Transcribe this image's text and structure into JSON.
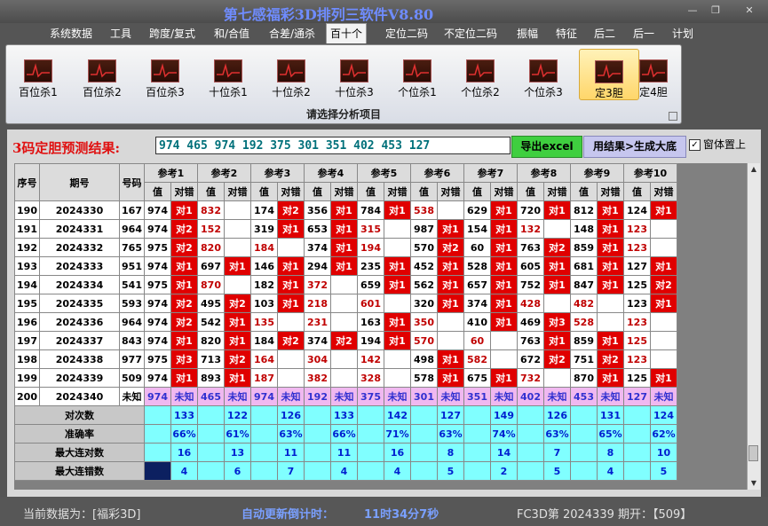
{
  "window": {
    "title": "第七感福彩3D排列三软件V8.80",
    "min": "—",
    "max": "❐",
    "close": "✕"
  },
  "menu": [
    "系统数据",
    "工具",
    "跨度/复式",
    "和/合值",
    "合差/通杀",
    "百十个",
    "定位二码",
    "不定位二码",
    "振幅",
    "特征",
    "后二",
    "后一",
    "计划"
  ],
  "menu_active": 5,
  "ribbon": {
    "buttons": [
      "百位杀1",
      "百位杀2",
      "百位杀3",
      "十位杀1",
      "十位杀2",
      "十位杀3",
      "个位杀1",
      "个位杀2",
      "个位杀3",
      "定3胆",
      "定4胆"
    ],
    "selected": 9,
    "caption": "请选择分析项目"
  },
  "prediction": {
    "label": "3码定胆预测结果:",
    "value": "974 465 974 192 375 301 351 402 453 127",
    "export_button": "导出excel",
    "generate_button": "用结果>生成大底",
    "ontop_label": "窗体置上",
    "ontop_checked": "✓"
  },
  "table": {
    "headers": {
      "seq": "序号",
      "period": "期号",
      "number": "号码",
      "val": "值",
      "cmp": "对错"
    },
    "refs": [
      "参考1",
      "参考2",
      "参考3",
      "参考4",
      "参考5",
      "参考6",
      "参考7",
      "参考8",
      "参考9",
      "参考10"
    ],
    "rows": [
      {
        "seq": "190",
        "period": "2024330",
        "num": "167",
        "refs": [
          [
            "974",
            "对1"
          ],
          [
            "832",
            ""
          ],
          [
            "174",
            "对2"
          ],
          [
            "356",
            "对1"
          ],
          [
            "784",
            "对1"
          ],
          [
            "538",
            ""
          ],
          [
            "629",
            "对1"
          ],
          [
            "720",
            "对1"
          ],
          [
            "812",
            "对1"
          ],
          [
            "124",
            "对1"
          ]
        ]
      },
      {
        "seq": "191",
        "period": "2024331",
        "num": "964",
        "refs": [
          [
            "974",
            "对2"
          ],
          [
            "152",
            ""
          ],
          [
            "319",
            "对1"
          ],
          [
            "653",
            "对1"
          ],
          [
            "315",
            ""
          ],
          [
            "987",
            "对1"
          ],
          [
            "154",
            "对1"
          ],
          [
            "132",
            ""
          ],
          [
            "148",
            "对1"
          ],
          [
            "123",
            ""
          ]
        ]
      },
      {
        "seq": "192",
        "period": "2024332",
        "num": "765",
        "refs": [
          [
            "975",
            "对2"
          ],
          [
            "820",
            ""
          ],
          [
            "184",
            ""
          ],
          [
            "374",
            "对1"
          ],
          [
            "194",
            ""
          ],
          [
            "570",
            "对2"
          ],
          [
            "60",
            "对1"
          ],
          [
            "763",
            "对2"
          ],
          [
            "859",
            "对1"
          ],
          [
            "123",
            ""
          ]
        ]
      },
      {
        "seq": "193",
        "period": "2024333",
        "num": "951",
        "refs": [
          [
            "974",
            "对1"
          ],
          [
            "697",
            "对1"
          ],
          [
            "146",
            "对1"
          ],
          [
            "294",
            "对1"
          ],
          [
            "235",
            "对1"
          ],
          [
            "452",
            "对1"
          ],
          [
            "528",
            "对1"
          ],
          [
            "605",
            "对1"
          ],
          [
            "681",
            "对1"
          ],
          [
            "127",
            "对1"
          ]
        ]
      },
      {
        "seq": "194",
        "period": "2024334",
        "num": "541",
        "refs": [
          [
            "975",
            "对1"
          ],
          [
            "870",
            ""
          ],
          [
            "182",
            "对1"
          ],
          [
            "372",
            ""
          ],
          [
            "659",
            "对1"
          ],
          [
            "562",
            "对1"
          ],
          [
            "657",
            "对1"
          ],
          [
            "752",
            "对1"
          ],
          [
            "847",
            "对1"
          ],
          [
            "125",
            "对2"
          ]
        ]
      },
      {
        "seq": "195",
        "period": "2024335",
        "num": "593",
        "refs": [
          [
            "974",
            "对2"
          ],
          [
            "495",
            "对2"
          ],
          [
            "103",
            "对1"
          ],
          [
            "218",
            ""
          ],
          [
            "601",
            ""
          ],
          [
            "320",
            "对1"
          ],
          [
            "374",
            "对1"
          ],
          [
            "428",
            ""
          ],
          [
            "482",
            ""
          ],
          [
            "123",
            "对1"
          ]
        ]
      },
      {
        "seq": "196",
        "period": "2024336",
        "num": "964",
        "refs": [
          [
            "974",
            "对2"
          ],
          [
            "542",
            "对1"
          ],
          [
            "135",
            ""
          ],
          [
            "231",
            ""
          ],
          [
            "163",
            "对1"
          ],
          [
            "350",
            ""
          ],
          [
            "410",
            "对1"
          ],
          [
            "469",
            "对3"
          ],
          [
            "528",
            ""
          ],
          [
            "123",
            ""
          ]
        ]
      },
      {
        "seq": "197",
        "period": "2024337",
        "num": "843",
        "refs": [
          [
            "974",
            "对1"
          ],
          [
            "820",
            "对1"
          ],
          [
            "184",
            "对2"
          ],
          [
            "374",
            "对2"
          ],
          [
            "194",
            "对1"
          ],
          [
            "570",
            ""
          ],
          [
            "60",
            ""
          ],
          [
            "763",
            "对1"
          ],
          [
            "859",
            "对1"
          ],
          [
            "125",
            ""
          ]
        ]
      },
      {
        "seq": "198",
        "period": "2024338",
        "num": "977",
        "refs": [
          [
            "975",
            "对3"
          ],
          [
            "713",
            "对2"
          ],
          [
            "164",
            ""
          ],
          [
            "304",
            ""
          ],
          [
            "142",
            ""
          ],
          [
            "498",
            "对1"
          ],
          [
            "582",
            ""
          ],
          [
            "672",
            "对2"
          ],
          [
            "751",
            "对2"
          ],
          [
            "123",
            ""
          ]
        ]
      },
      {
        "seq": "199",
        "period": "2024339",
        "num": "509",
        "refs": [
          [
            "974",
            "对1"
          ],
          [
            "893",
            "对1"
          ],
          [
            "187",
            ""
          ],
          [
            "382",
            ""
          ],
          [
            "328",
            ""
          ],
          [
            "578",
            "对1"
          ],
          [
            "675",
            "对1"
          ],
          [
            "732",
            ""
          ],
          [
            "870",
            "对1"
          ],
          [
            "125",
            "对1"
          ]
        ]
      }
    ],
    "pred_row": {
      "seq": "200",
      "period": "2024340",
      "num": "未知",
      "refs": [
        [
          "974",
          "未知"
        ],
        [
          "465",
          "未知"
        ],
        [
          "974",
          "未知"
        ],
        [
          "192",
          "未知"
        ],
        [
          "375",
          "未知"
        ],
        [
          "301",
          "未知"
        ],
        [
          "351",
          "未知"
        ],
        [
          "402",
          "未知"
        ],
        [
          "453",
          "未知"
        ],
        [
          "127",
          "未知"
        ]
      ]
    },
    "stats": [
      {
        "label": "对次数",
        "vals": [
          "133",
          "122",
          "126",
          "133",
          "142",
          "127",
          "149",
          "126",
          "131",
          "124"
        ]
      },
      {
        "label": "准确率",
        "vals": [
          "66%",
          "61%",
          "63%",
          "66%",
          "71%",
          "63%",
          "74%",
          "63%",
          "65%",
          "62%"
        ]
      },
      {
        "label": "最大连对数",
        "vals": [
          "16",
          "13",
          "11",
          "11",
          "16",
          "8",
          "14",
          "7",
          "8",
          "10"
        ]
      },
      {
        "label": "最大连错数",
        "vals": [
          "4",
          "6",
          "7",
          "4",
          "4",
          "5",
          "2",
          "5",
          "4",
          "5"
        ]
      }
    ]
  },
  "status": {
    "current_data": "当前数据为：[福彩3D]",
    "countdown_label": "自动更新倒计时：",
    "countdown_value": "11时34分7秒",
    "issue": "FC3D第 2024339 期开：【509】"
  },
  "colors": {
    "hit": "#e00000",
    "stat_bg": "#80ffff",
    "pred_row": "#f0b8f0",
    "prediction_text": "#00707a"
  }
}
